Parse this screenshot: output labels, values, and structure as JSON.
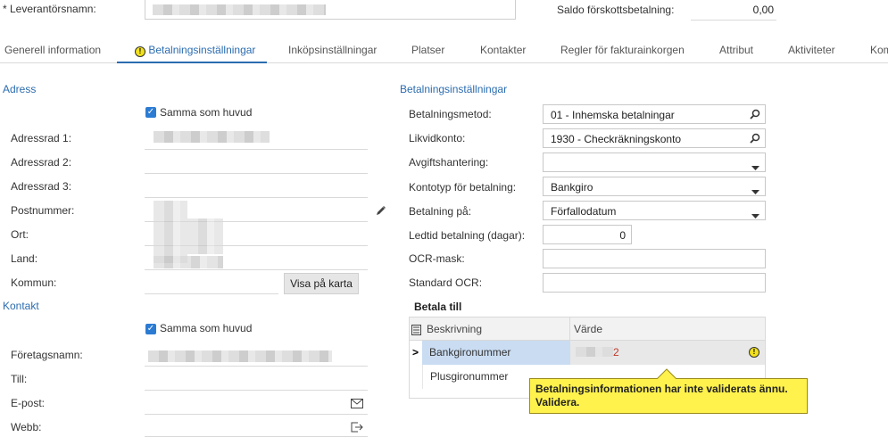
{
  "header": {
    "supplier_name_label": "* Leverantörsnamn:",
    "prepay_label": "Saldo förskottsbetalning:",
    "prepay_value": "0,00"
  },
  "tabs": [
    {
      "label": "Generell information"
    },
    {
      "label": "Betalningsinställningar"
    },
    {
      "label": "Inköpsinställningar"
    },
    {
      "label": "Platser"
    },
    {
      "label": "Kontakter"
    },
    {
      "label": "Regler för fakturainkorgen"
    },
    {
      "label": "Attribut"
    },
    {
      "label": "Aktiviteter"
    },
    {
      "label": "Kom"
    }
  ],
  "address": {
    "title": "Adress",
    "same_as_main": "Samma som huvud",
    "rows": [
      "Adressrad 1:",
      "Adressrad 2:",
      "Adressrad 3:",
      "Postnummer:",
      "Ort:",
      "Land:",
      "Kommun:"
    ],
    "map_button": "Visa på karta"
  },
  "contact": {
    "title": "Kontakt",
    "same_as_main": "Samma som huvud",
    "rows": [
      "Företagsnamn:",
      "Till:",
      "E-post:",
      "Webb:"
    ]
  },
  "payment": {
    "title": "Betalningsinställningar",
    "method_label": "Betalningsmetod:",
    "method_value": "01 - Inhemska betalningar",
    "account_label": "Likvidkonto:",
    "account_value": "1930 - Checkräkningskonto",
    "fee_label": "Avgiftshantering:",
    "fee_value": "",
    "acct_type_label": "Kontotyp för betalning:",
    "acct_type_value": "Bankgiro",
    "pay_on_label": "Betalning på:",
    "pay_on_value": "Förfallodatum",
    "lead_label": "Ledtid betalning (dagar):",
    "lead_value": "0",
    "ocr_mask_label": "OCR-mask:",
    "ocr_mask_value": "",
    "std_ocr_label": "Standard OCR:",
    "std_ocr_value": ""
  },
  "pay_to": {
    "title": "Betala till",
    "col_desc": "Beskrivning",
    "col_value": "Värde",
    "rows": [
      {
        "desc": "Bankgironummer",
        "value": "2"
      },
      {
        "desc": "Plusgironummer",
        "value": ""
      }
    ],
    "tooltip": "Betalningsinformationen har inte validerats ännu. Validera."
  },
  "colors": {
    "accent": "#2b6cb0",
    "checkbox": "#2b7bd3",
    "tooltip_bg": "#fff24c",
    "selected_row": "#c9dcf2"
  }
}
